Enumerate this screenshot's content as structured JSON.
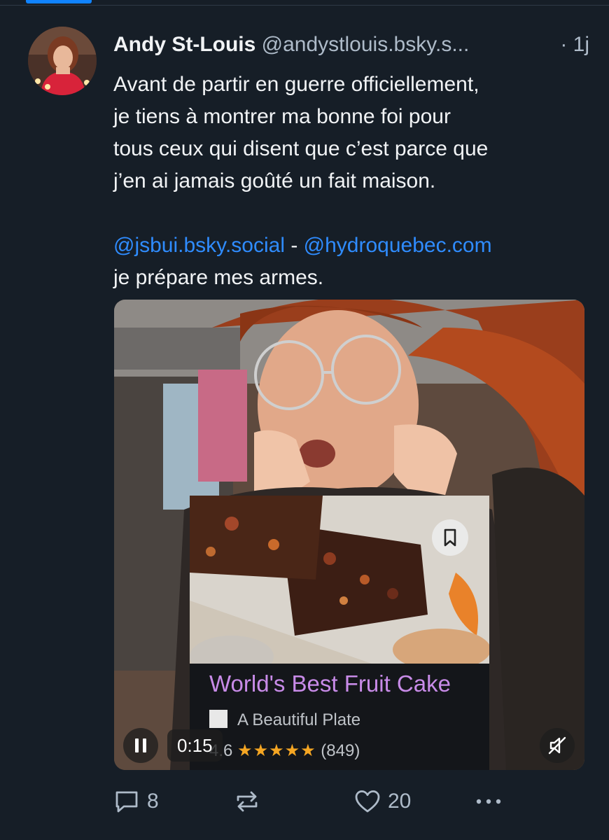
{
  "post": {
    "author": {
      "name": "Andy St-Louis",
      "handle": "@andystlouis.bsky.s...",
      "time": "· 1j"
    },
    "text": {
      "line1": "Avant de partir en guerre officiellement,",
      "line2": "je tiens à montrer ma bonne foi pour",
      "line3": "tous ceux qui disent que c’est parce que",
      "line4": "j’en ai jamais goûté un fait maison.",
      "mention1": "@jsbui.bsky.social",
      "separator": " - ",
      "mention2": "@hydroquebec.com",
      "last_line": "je prépare mes armes."
    },
    "video": {
      "time": "0:15",
      "overlay_card": {
        "title": "World's Best Fruit Cake",
        "source": "A Beautiful Plate",
        "rating": "4.6",
        "stars": "★★★★★",
        "reviews": "(849)"
      }
    },
    "actions": {
      "replies": "8",
      "reposts": "",
      "likes": "20"
    }
  },
  "icons": {
    "reply": "reply-icon",
    "repost": "repost-icon",
    "like": "heart-icon",
    "more": "more-options-icon",
    "pause": "pause-icon",
    "mute": "muted-speaker-icon",
    "bookmark": "bookmark-icon"
  },
  "colors": {
    "background": "#161e27",
    "text": "#f1f3f5",
    "muted": "#aebbc9",
    "accent": "#1083fe",
    "mention": "#2f8cff",
    "card_title": "#c88be8",
    "stars": "#f5a623"
  }
}
